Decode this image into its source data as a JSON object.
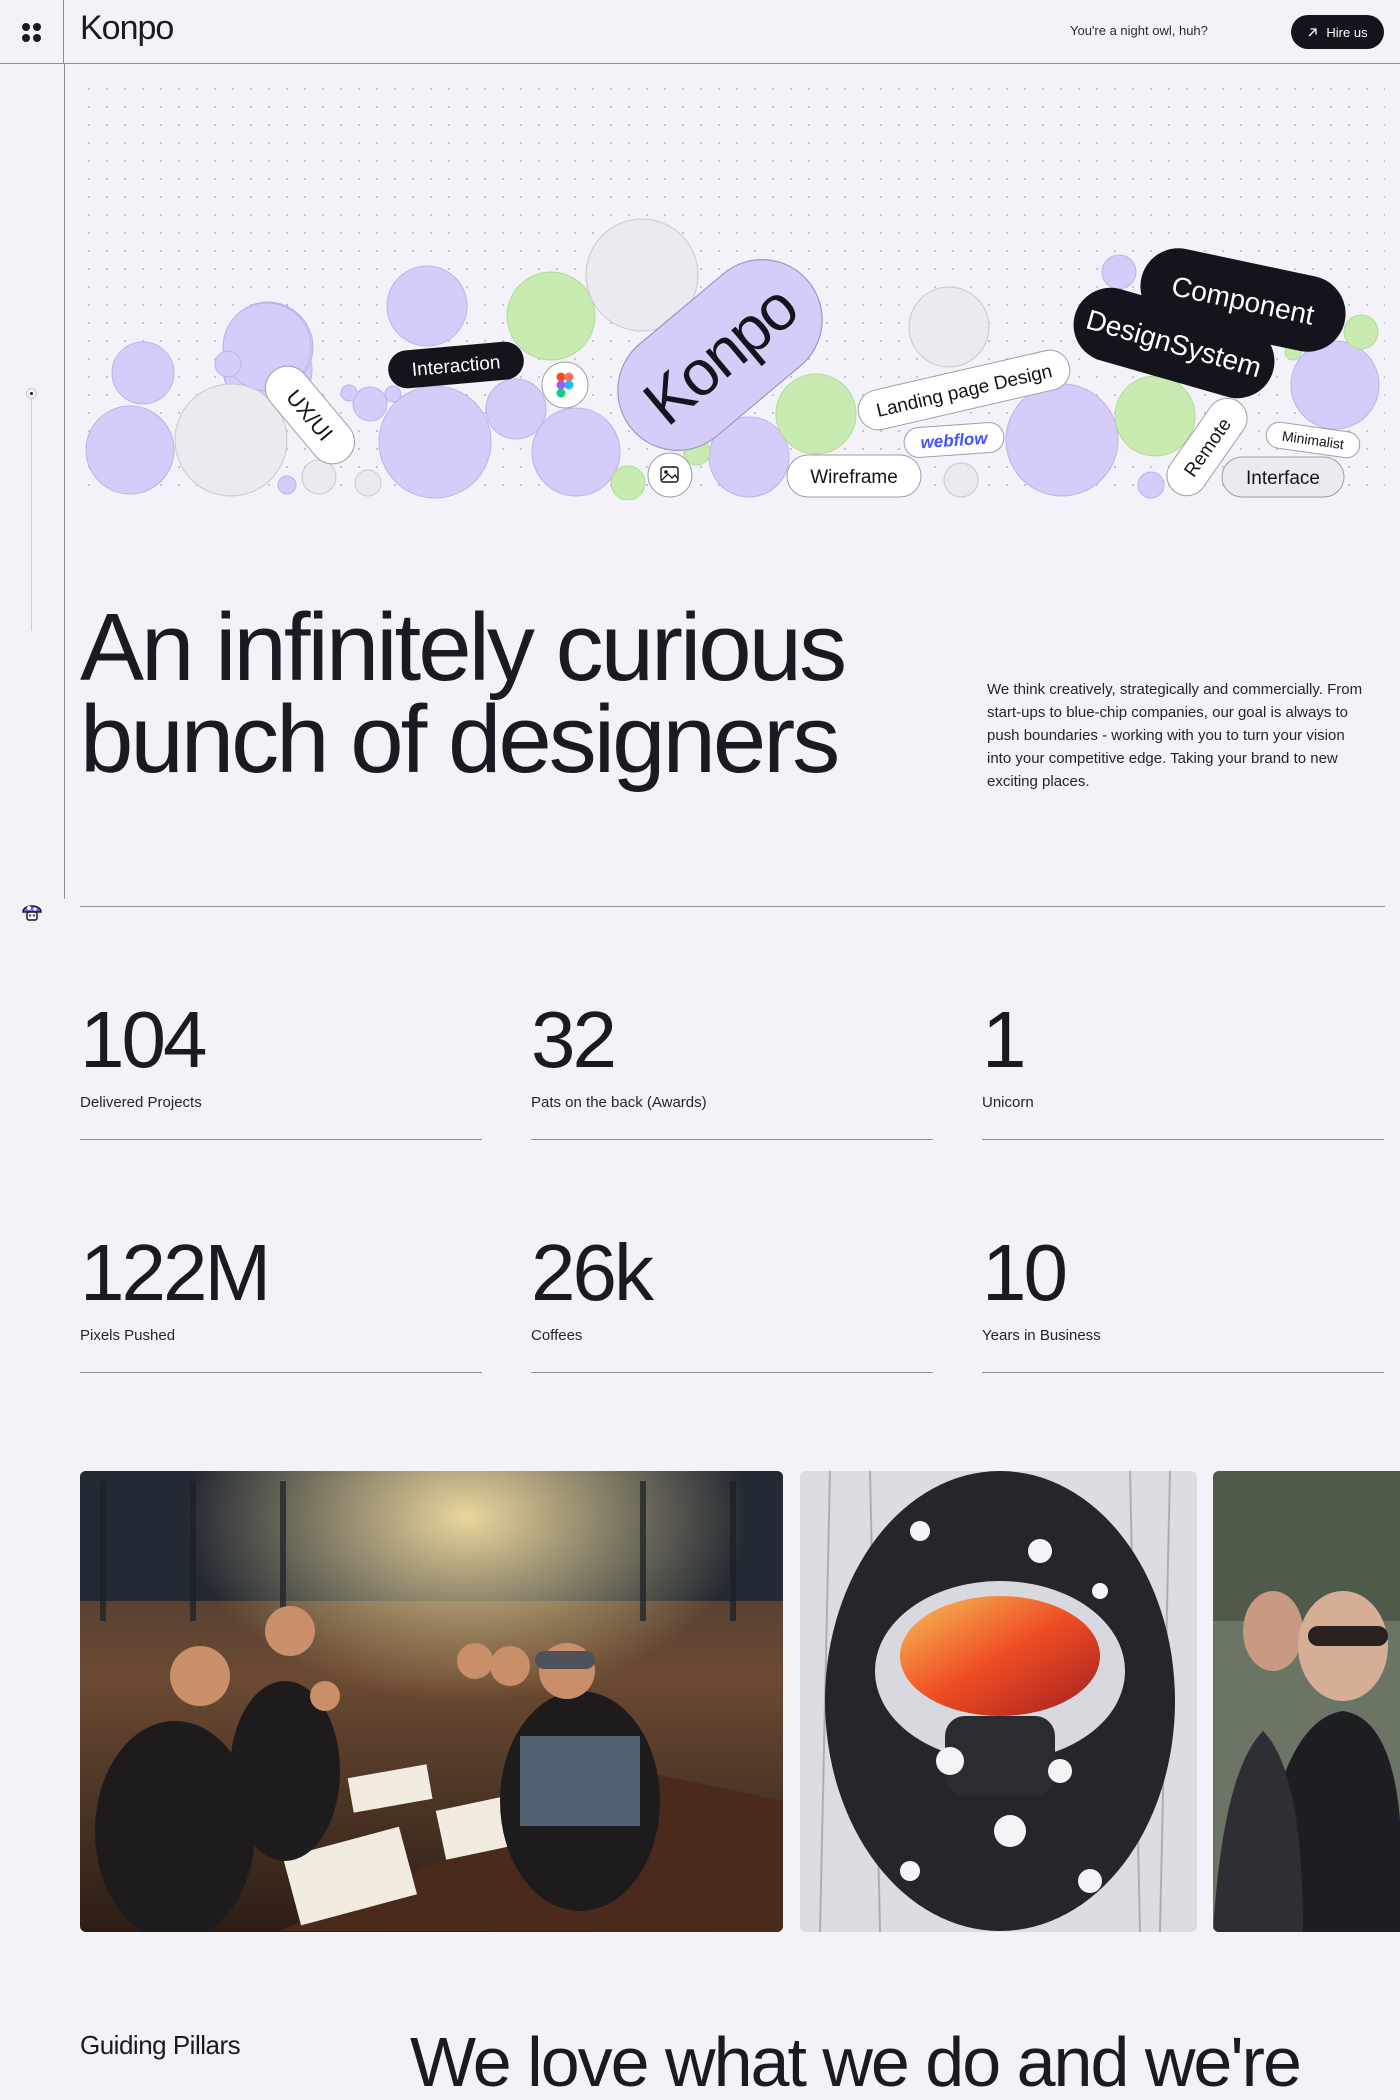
{
  "brand": {
    "logo_text": "Konpo",
    "tagline": "You're a night owl, huh?",
    "hire_label": "Hire us"
  },
  "hero": {
    "main_pill": "Konpo",
    "tags": {
      "ux_ui": "UX/UI",
      "interaction": "Interaction",
      "landing": "Landing page Design",
      "webflow": "webflow",
      "wireframe": "Wireframe",
      "component": "Component",
      "design_system": "DesignSystem",
      "remote": "Remote",
      "minimalist": "Minimalist",
      "interface": "Interface"
    },
    "colors": {
      "lavender": "#d5ccfa",
      "green": "#c8ebb2",
      "grey": "#ebeaee",
      "dark": "#15141c"
    }
  },
  "headline": {
    "line1": "An infinitely curious",
    "line2": "bunch of designers"
  },
  "intro": "We think creatively, strategically and commercially. From start-ups to blue-chip companies, our goal is always to push boundaries - working with you to turn your vision into your competitive edge. Taking your brand to new exciting places.",
  "stats": [
    {
      "value": "104",
      "label": "Delivered Projects"
    },
    {
      "value": "32",
      "label": "Pats on the back (Awards)"
    },
    {
      "value": "1",
      "label": "Unicorn"
    },
    {
      "value": "122M",
      "label": "Pixels Pushed"
    },
    {
      "value": "26k",
      "label": "Coffees"
    },
    {
      "value": "10",
      "label": "Years in Business"
    }
  ],
  "photos": [
    {
      "alt": "team-dinner-photo"
    },
    {
      "alt": "snow-goggles-photo"
    },
    {
      "alt": "team-member-photo"
    }
  ],
  "pillars": {
    "label": "Guiding Pillars",
    "heading": "We love what we do and we're"
  }
}
